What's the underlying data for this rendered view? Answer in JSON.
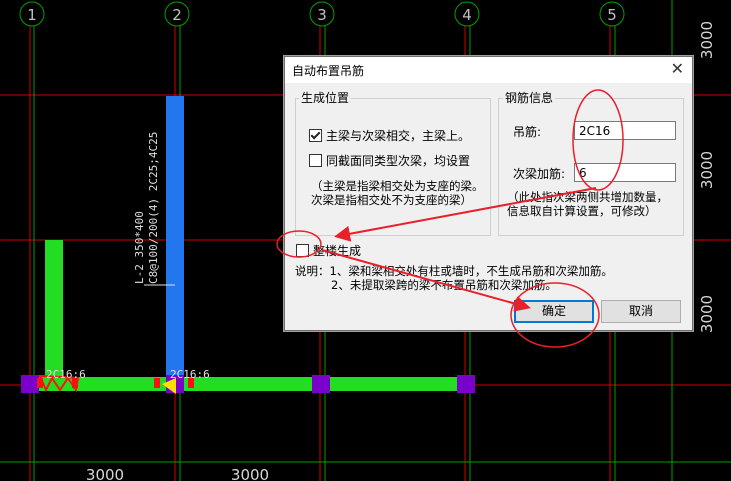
{
  "cad": {
    "axis_labels": [
      "1",
      "2",
      "3",
      "4",
      "5"
    ],
    "beam_label": "L-2 350*400",
    "beam_stirrup": "C8@100/200(4) 2C25;4C25",
    "rebar_tag_1": "2C16:6",
    "rebar_tag_2": "2C16:6",
    "right_dims": [
      "3000",
      "3000",
      "3000"
    ],
    "bottom_dims": [
      "3000",
      "3000"
    ]
  },
  "dialog": {
    "title": "自动布置吊筋",
    "close_glyph": "✕",
    "position_group": {
      "label": "生成位置",
      "option1": {
        "label": "主梁与次梁相交，主梁上。",
        "checked": true
      },
      "option2": {
        "label": "同截面同类型次梁，均设置",
        "checked": false
      },
      "note_line1": "（主梁是指梁相交处为支座的梁。",
      "note_line2": "次梁是指相交处不为支座的梁）"
    },
    "rebar_group": {
      "label": "钢筋信息",
      "hanger_label": "吊筋:",
      "hanger_value": "2C16",
      "secondary_label": "次梁加筋:",
      "secondary_value": "6",
      "note_line1": "（此处指次梁两侧共增加数量，",
      "note_line2": "信息取自计算设置，可修改）"
    },
    "whole_floor": {
      "label": "整楼生成",
      "checked": false
    },
    "explain_line1": "说明：1、梁和梁相交处有柱或墙时，不生成吊筋和次梁加筋。",
    "explain_line2": "2、未提取梁跨的梁不布置吊筋和次梁加筋。",
    "ok_label": "确定",
    "cancel_label": "取消"
  },
  "colors": {
    "grid_red": "#e00000",
    "grid_green": "#00a000",
    "beam_green": "#22dd22",
    "beam_blue": "#2277ee",
    "column_purple": "#7a00cc",
    "annotation_red": "#e8202a"
  }
}
